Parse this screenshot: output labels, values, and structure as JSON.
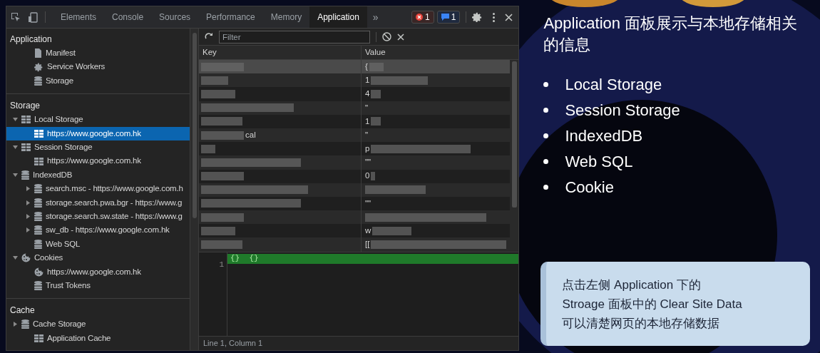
{
  "devtools": {
    "toolbar": {
      "tabs": [
        {
          "label": "Elements",
          "selected": false
        },
        {
          "label": "Console",
          "selected": false
        },
        {
          "label": "Sources",
          "selected": false
        },
        {
          "label": "Performance",
          "selected": false
        },
        {
          "label": "Memory",
          "selected": false
        },
        {
          "label": "Application",
          "selected": true
        }
      ],
      "more": "»",
      "errors": "1",
      "messages": "1"
    },
    "sidebar": {
      "sections": [
        {
          "title": "Application",
          "items": [
            {
              "label": "Manifest",
              "kind": "file",
              "selected": false
            },
            {
              "label": "Service Workers",
              "kind": "gear",
              "selected": false
            },
            {
              "label": "Storage",
              "kind": "database",
              "selected": false
            }
          ]
        },
        {
          "title": "Storage",
          "items": [
            {
              "label": "Local Storage",
              "kind": "grid",
              "expanded": true,
              "selected": false,
              "children": [
                {
                  "label": "https://www.google.com.hk",
                  "kind": "grid",
                  "selected": true
                }
              ]
            },
            {
              "label": "Session Storage",
              "kind": "grid",
              "expanded": true,
              "selected": false,
              "children": [
                {
                  "label": "https://www.google.com.hk",
                  "kind": "grid",
                  "selected": false
                }
              ]
            },
            {
              "label": "IndexedDB",
              "kind": "database",
              "expanded": true,
              "selected": false,
              "children": [
                {
                  "label": "search.msc - https://www.google.com.h",
                  "kind": "database",
                  "expanded": false,
                  "selected": false
                },
                {
                  "label": "storage.search.pwa.bgr - https://www.g",
                  "kind": "database",
                  "expanded": false,
                  "selected": false
                },
                {
                  "label": "storage.search.sw.state - https://www.g",
                  "kind": "database",
                  "expanded": false,
                  "selected": false
                },
                {
                  "label": "sw_db - https://www.google.com.hk",
                  "kind": "database",
                  "expanded": false,
                  "selected": false
                }
              ]
            },
            {
              "label": "Web SQL",
              "kind": "database",
              "selected": false
            },
            {
              "label": "Cookies",
              "kind": "cookie",
              "expanded": true,
              "selected": false,
              "children": [
                {
                  "label": "https://www.google.com.hk",
                  "kind": "cookie",
                  "selected": false
                }
              ]
            },
            {
              "label": "Trust Tokens",
              "kind": "database",
              "selected": false
            }
          ]
        },
        {
          "title": "Cache",
          "items": [
            {
              "label": "Cache Storage",
              "kind": "database",
              "expanded": false,
              "selected": false
            },
            {
              "label": "Application Cache",
              "kind": "grid",
              "selected": false
            }
          ]
        }
      ]
    },
    "filter": {
      "placeholder": "Filter"
    },
    "table": {
      "columns": [
        "Key",
        "Value"
      ],
      "rows": [
        {
          "value": "{",
          "selected": true
        },
        {
          "value": "1",
          "selected": false
        },
        {
          "value": "4",
          "selected": false
        },
        {
          "value": "\"",
          "selected": false
        },
        {
          "value": "1",
          "selected": false
        },
        {
          "key": "cal",
          "value": "\"",
          "selected": false
        },
        {
          "value": "p",
          "selected": false
        },
        {
          "value": "\"\"",
          "selected": false
        },
        {
          "value": "0",
          "selected": false
        },
        {
          "selected": false
        },
        {
          "value": "\"\"",
          "selected": false
        },
        {
          "selected": false
        },
        {
          "value": "w",
          "selected": false
        },
        {
          "value": "[[",
          "selected": false
        }
      ]
    },
    "preview": {
      "line_number": "1",
      "code": "{}  {}"
    },
    "status_bar": "Line 1, Column 1"
  },
  "slide": {
    "title": "Application 面板展示与本地存储相关的信息",
    "bullets": [
      "Local Storage",
      "Session Storage",
      "IndexedDB",
      "Web SQL",
      "Cookie"
    ],
    "note": [
      "点击左侧 Application 下的",
      "Stroage 面板中的 Clear Site Data",
      "可以清楚网页的本地存储数据"
    ]
  }
}
